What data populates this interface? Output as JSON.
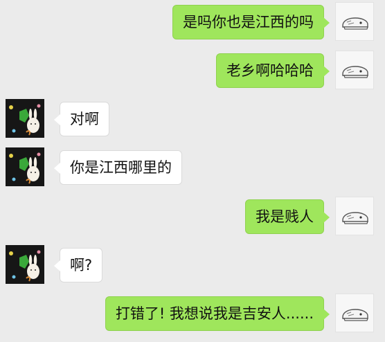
{
  "chat": {
    "messages": [
      {
        "sender": "me",
        "text": "是吗你也是江西的吗"
      },
      {
        "sender": "me",
        "text": "老乡啊哈哈哈"
      },
      {
        "sender": "them",
        "text": "对啊"
      },
      {
        "sender": "them",
        "text": "你是江西哪里的"
      },
      {
        "sender": "me",
        "text": "我是贱人"
      },
      {
        "sender": "them",
        "text": "啊?"
      },
      {
        "sender": "me",
        "text": "打错了!  我想说我是吉安人......"
      }
    ]
  },
  "colors": {
    "background": "#ebebeb",
    "outgoing_bubble": "#9fe65c",
    "incoming_bubble": "#ffffff"
  },
  "icons": {
    "me_avatar": "sketch-shoe-avatar-icon",
    "them_avatar": "cartoon-animals-avatar-icon"
  }
}
